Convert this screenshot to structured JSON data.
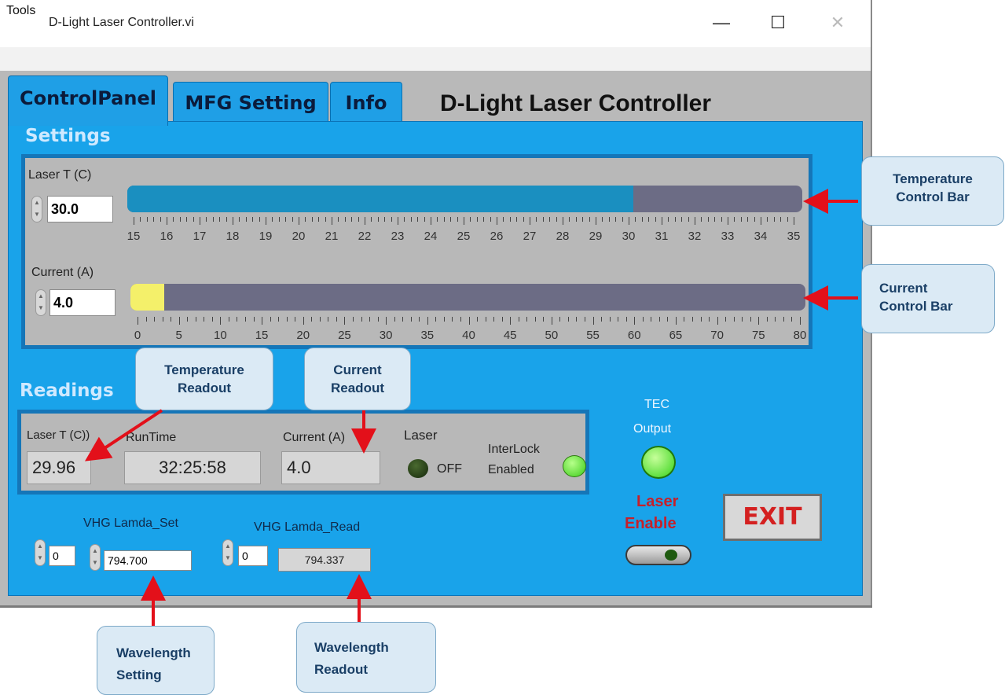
{
  "window": {
    "title": "D-Light Laser Controller.vi",
    "minimize_glyph": "—",
    "maximize_glyph": "☐",
    "close_glyph": "✕"
  },
  "menu": {
    "tools": "Tools"
  },
  "tabs": [
    {
      "label": "ControlPanel",
      "active": true
    },
    {
      "label": "MFG Setting",
      "active": false
    },
    {
      "label": "Info",
      "active": false
    }
  ],
  "app_title": "D-Light Laser Controller",
  "settings": {
    "title": "Settings",
    "temperature": {
      "label": "Laser T (C)",
      "value": "30.0",
      "min": 15,
      "max": 35,
      "current": 30.0,
      "ticks": [
        "15",
        "16",
        "17",
        "18",
        "19",
        "20",
        "21",
        "22",
        "23",
        "24",
        "25",
        "26",
        "27",
        "28",
        "29",
        "30",
        "31",
        "32",
        "33",
        "34",
        "35"
      ]
    },
    "current": {
      "label": "Current (A)",
      "value": "4.0",
      "min": 0,
      "max": 80,
      "current": 4.0,
      "ticks": [
        "0",
        "5",
        "10",
        "15",
        "20",
        "25",
        "30",
        "35",
        "40",
        "45",
        "50",
        "55",
        "60",
        "65",
        "70",
        "75",
        "80"
      ]
    }
  },
  "readings": {
    "title": "Readings",
    "laser_t_label": "Laser T (C))",
    "laser_t_value": "29.96",
    "runtime_label": "RunTime",
    "runtime_value": "32:25:58",
    "current_label": "Current (A)",
    "current_value": "4.0",
    "laser_label": "Laser",
    "laser_state": "OFF",
    "interlock_label_1": "InterLock",
    "interlock_label_2": "Enabled",
    "tec_label_1": "TEC",
    "tec_label_2": "Output"
  },
  "vhg": {
    "set_label": "VHG Lamda_Set",
    "set_index": "0",
    "set_value": "794.700",
    "read_label": "VHG Lamda_Read",
    "read_index": "0",
    "read_value": "794.337"
  },
  "laser_enable": {
    "line1": "Laser",
    "line2": "Enable"
  },
  "exit_label": "EXIT",
  "callouts": {
    "temp_bar_1": "Temperature",
    "temp_bar_2": "Control Bar",
    "current_bar_1": "Current",
    "current_bar_2": "Control Bar",
    "temp_readout_1": "Temperature",
    "temp_readout_2": "Readout",
    "current_readout_1": "Current",
    "current_readout_2": "Readout",
    "wl_setting_1": "Wavelength",
    "wl_setting_2": "Setting",
    "wl_readout_1": "Wavelength",
    "wl_readout_2": "Readout"
  },
  "colors": {
    "panel_blue": "#19a3ea",
    "temp_fill": "#1a8fc0",
    "current_fill": "#f4f06a",
    "track": "#6c6c85",
    "led_green": "#4ee62a",
    "led_off": "#1f3b12",
    "arrow_red": "#e3101a"
  }
}
